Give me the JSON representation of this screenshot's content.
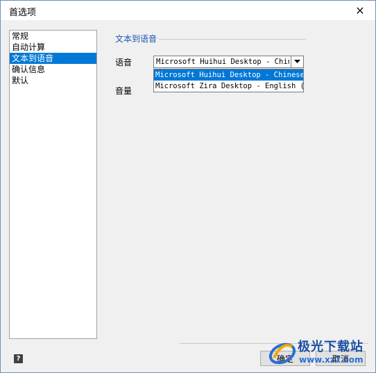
{
  "window": {
    "title": "首选项",
    "close_glyph": "✕"
  },
  "sidebar": {
    "items": [
      {
        "label": "常规",
        "selected": false
      },
      {
        "label": "自动计算",
        "selected": false
      },
      {
        "label": "文本到语音",
        "selected": true
      },
      {
        "label": "确认信息",
        "selected": false
      },
      {
        "label": "默认",
        "selected": false
      }
    ]
  },
  "main": {
    "section_title": "文本到语音",
    "voice_label": "语音",
    "volume_label": "音量",
    "voice_combo": {
      "value": "Microsoft Huihui Desktop - Chinese (Simplified)"
    },
    "voice_options": [
      {
        "label": "Microsoft Huihui Desktop - Chinese (Simplified)",
        "selected": true
      },
      {
        "label": "Microsoft Zira Desktop - English (United States)",
        "selected": false
      }
    ]
  },
  "footer": {
    "help_label": "?",
    "ok_label": "确定",
    "cancel_label": "取消"
  },
  "watermark": {
    "brand": "极光下载站",
    "url": "www.xz7.com"
  },
  "colors": {
    "selection": "#0078d7",
    "section_title": "#1a56b0",
    "window_bg": "#f0f0f0"
  }
}
